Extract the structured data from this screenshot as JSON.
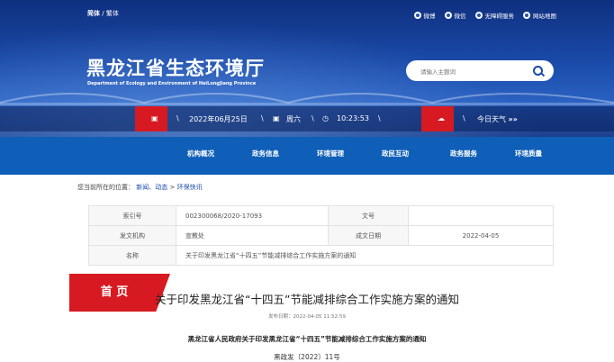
{
  "header": {
    "lang_simplified": "简体",
    "lang_sep": "/",
    "lang_traditional": "繁体",
    "links": [
      "微博",
      "微信",
      "无障碍服务",
      "网站地图"
    ],
    "title": "黑龙江省生态环境厅",
    "subtitle": "Department of Ecology and Environment of HeiLongJiang Province",
    "search_placeholder": "请输入主题词"
  },
  "datebar": {
    "date": "2022年06月25日",
    "weekday": "周六",
    "time": "10:23:53",
    "weather": "今日天气",
    "sep": "\\"
  },
  "nav": {
    "home": "首 页",
    "items": [
      "机构概况",
      "政务信息",
      "环境管理",
      "政民互动",
      "政务服务",
      "环境质量"
    ]
  },
  "breadcrumb": {
    "prefix": "您当前所在的位置：",
    "part1": "新闻、动态",
    "sep": ">",
    "part2": "环保快讯"
  },
  "info": {
    "index_label": "索引号",
    "index_value": "002300068/2020-17093",
    "docno_label": "文号",
    "docno_value": "",
    "issuer_label": "发文机构",
    "issuer_value": "宣教处",
    "date_label": "成文日期",
    "date_value": "2022-04-05",
    "name_label": "名称",
    "name_value": "关于印发黑龙江省“十四五”节能减排综合工作实施方案的通知"
  },
  "article": {
    "title": "关于印发黑龙江省“十四五”节能减排综合工作实施方案的通知",
    "pubdate": "发布日期：2022-04-05 11:52:59",
    "body_title": "黑龙江省人民政府关于印发黑龙江省“十四五”节能减排综合工作实施方案的通知",
    "doc_number": "黑政发〔2022〕11号"
  },
  "colors": {
    "brand_blue": "#0f5fb8",
    "accent_red": "#d71a21"
  }
}
